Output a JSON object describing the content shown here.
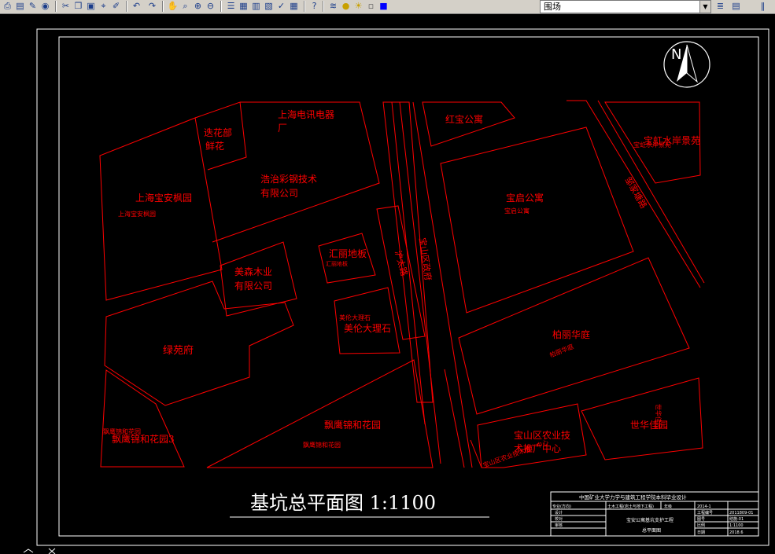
{
  "toolbar": {
    "layer_name": "围场",
    "icons": [
      "print-icon",
      "preview-icon",
      "publish-icon",
      "globe-icon",
      "cut-icon",
      "copy-icon",
      "paste-icon",
      "match-properties-icon",
      "brush-icon",
      "undo-icon",
      "redo-icon",
      "pan-icon",
      "zoom-realtime-icon",
      "zoom-window-icon",
      "zoom-previous-icon",
      "properties-icon",
      "design-center-icon",
      "tool-palette-icon",
      "sheet-set-icon",
      "markup-icon",
      "calculator-icon",
      "help-icon",
      "layer-manager-icon",
      "layer-state-icon"
    ]
  },
  "north_arrow": {
    "letter": "N"
  },
  "plots": {
    "p1": {
      "name": "上海宝安枫园",
      "sub": "上海宝安枫园"
    },
    "p2": {
      "name": "迭花部",
      "name2": "鲜花"
    },
    "p3": {
      "name": "上海电讯电器",
      "name2": "厂"
    },
    "p4": {
      "name": "浩治彩钢技术",
      "name2": "有限公司"
    },
    "p5": {
      "name": "红宝公寓"
    },
    "p6": {
      "name": "宝虹水岸景苑",
      "sub": "宝虹水岸景苑"
    },
    "p7": {
      "name": "宝启公寓",
      "sub": "宝启公寓"
    },
    "p8": {
      "name": "美森木业",
      "name2": "有限公司"
    },
    "p9": {
      "name": "汇丽地板",
      "sub": "汇丽地板"
    },
    "p10": {
      "name": "美伦大理石",
      "sub": "美伦大理石"
    },
    "p11": {
      "name": "绿苑府"
    },
    "p12": {
      "name": "柏丽华庭",
      "sub": "柏丽华庭"
    },
    "p13": {
      "name": "飘鹰锦和花园",
      "sub": "飘鹰锦和花园"
    },
    "p14": {
      "name": "飘鹰锦和花园3",
      "sub": "飘鹰锦和花园"
    },
    "p15": {
      "name": "宝山区农业技",
      "name2": "术推广中心",
      "sub": "宝山区农业技术推广中心"
    },
    "p16": {
      "name": "世华佳园",
      "sub": "世华佳园"
    },
    "road1": {
      "name": "沪太路"
    },
    "road2": {
      "name": "宝山区政府"
    },
    "road3": {
      "name": "邹家塘路"
    }
  },
  "drawing_title": "基坑总平面图  1:1100",
  "title_block": {
    "header": "中国矿业大学力学与建筑工程学院本科毕业设计",
    "cells": [
      "专业(方向)",
      "土木工程(岩土与地下工程)",
      "年级",
      "2014-1",
      "设计",
      "校对",
      "审核",
      "工程编号",
      "2011809-01",
      "图号",
      "结施-01",
      "比例",
      "1:1100",
      "日期",
      "2018.6"
    ],
    "project": "宝安公寓基坑支护工程",
    "drawing_name": "总平面图"
  }
}
